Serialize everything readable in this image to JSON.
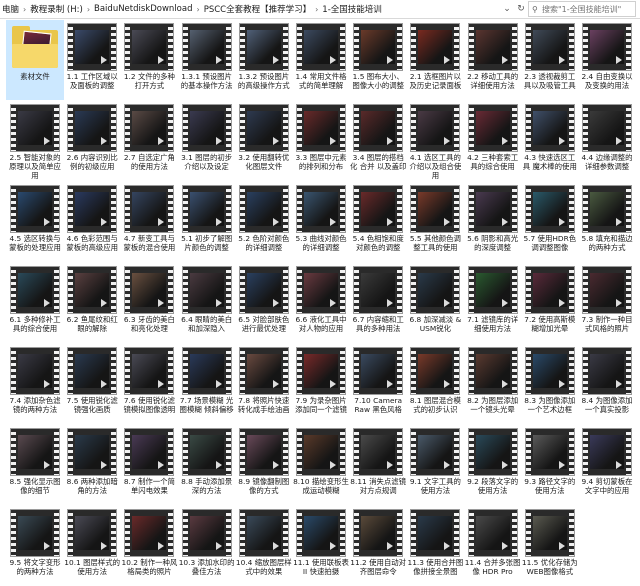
{
  "address": {
    "crumbs": [
      "电脑",
      "教程录制 (H:)",
      "BaiduNetdiskDownload",
      "PSCC全套教程【推荐学习】",
      "1-全国技能培训"
    ],
    "separator": "›",
    "refresh_icon": "refresh-icon",
    "search_placeholder": "搜索\"1-全国技能培训\""
  },
  "files": [
    {
      "name": "素材文件",
      "type": "folder",
      "selected": true
    },
    {
      "name": "1.1 工作区域以及面板的调整",
      "color": "#3a4a6a"
    },
    {
      "name": "1.2 文件的多种打开方式",
      "color": "#4a4a55"
    },
    {
      "name": "1.3.1 预设图片的基本操作方法",
      "color": "#556070"
    },
    {
      "name": "1.3.2 预设图片的高级操作方式",
      "color": "#506078"
    },
    {
      "name": "1.4 常用文件格式的简单理解",
      "color": "#3c4a60"
    },
    {
      "name": "1.5 图布大小、图像大小的调整",
      "color": "#6a3a2a"
    },
    {
      "name": "2.1 选框图片以及历史记录面板",
      "color": "#7a2a20"
    },
    {
      "name": "2.2 移动工具的详细使用方法",
      "color": "#5a3530"
    },
    {
      "name": "2.3 透视裁剪工具以及吸管工具",
      "color": "#404a58"
    },
    {
      "name": "2.4 自由变换以及变换的用法",
      "color": "#6a4060"
    },
    {
      "name": "2.5 智能对象的原理以及简单应用",
      "color": "#3a3a45"
    },
    {
      "name": "2.6 内容识别比例的初级应用",
      "color": "#2a3a55"
    },
    {
      "name": "2.7 自选定广角的使用方法",
      "color": "#5a4a45"
    },
    {
      "name": "3.1 图层的初步介绍以及设定",
      "color": "#3a3a50"
    },
    {
      "name": "3.2 使用翻转优化图层文件",
      "color": "#2e3a50"
    },
    {
      "name": "3.3 图层中元素的排列和分布",
      "color": "#6a2a2a"
    },
    {
      "name": "3.4 图层的搭档化 合并 以及盖印",
      "color": "#5a2a2a"
    },
    {
      "name": "4.1 选区工具的介绍以及组合使用",
      "color": "#4a3a45"
    },
    {
      "name": "4.2 三种套索工具的综合使用",
      "color": "#6a2a35"
    },
    {
      "name": "4.3 快速选区工具 魔术棒的使用",
      "color": "#40506a"
    },
    {
      "name": "4.4 边缘调整的详细参数调整",
      "color": "#3a3a3a"
    },
    {
      "name": "4.5 选区转换与蒙板的处理应用",
      "color": "#2a4a70"
    },
    {
      "name": "4.6 色彩范围与蒙板的高级应用",
      "color": "#2a3a60"
    },
    {
      "name": "4.7 新变工具与蒙板的混合使用",
      "color": "#354560"
    },
    {
      "name": "5.1 初步了解图片颜色的调整",
      "color": "#3a5070"
    },
    {
      "name": "5.2 色阶对颜色的详细调整",
      "color": "#2a4060"
    },
    {
      "name": "5.3 曲线对颜色的详细调整",
      "color": "#3a5570"
    },
    {
      "name": "5.4 色相饱和度对颜色的调整",
      "color": "#6a2a2a"
    },
    {
      "name": "5.5 其他颜色调整工具的使用",
      "color": "#7a3a2a"
    },
    {
      "name": "5.6 阴影和高光的深度调整",
      "color": "#4a3a50"
    },
    {
      "name": "5.7 使用HDR色调调整图像",
      "color": "#2a5a6a"
    },
    {
      "name": "5.8 填充和描边的两种方式",
      "color": "#4a5a40"
    },
    {
      "name": "6.1 多种修补工具的综合使用",
      "color": "#2a4a5a"
    },
    {
      "name": "6.2 鱼尾纹和红眼的解除",
      "color": "#5a4040"
    },
    {
      "name": "6.3 牙齿的美白和亮化处理",
      "color": "#6a5040"
    },
    {
      "name": "6.4 眼睛的美白和加深隐入",
      "color": "#4a3a40"
    },
    {
      "name": "6.5 对脸部肤色进行最优处理",
      "color": "#2a4060"
    },
    {
      "name": "6.6 液化工具中对人物的应用",
      "color": "#6a3a40"
    },
    {
      "name": "6.7 内容缩和工具的多种用法",
      "color": "#3a3a3a"
    },
    {
      "name": "6.8 加深减淡 & USM锐化",
      "color": "#2a3a4a"
    },
    {
      "name": "7.1 滤镜库的详细使用方法",
      "color": "#2a5a30"
    },
    {
      "name": "7.2 使用高斯模糊增加光晕",
      "color": "#5a2a3a"
    },
    {
      "name": "7.3 制作一种目式风格的照片",
      "color": "#4a2a30"
    },
    {
      "name": "7.4 添加杂色滤镜的两种方法",
      "color": "#3a3a45"
    },
    {
      "name": "7.5 使用锐化滤镜强化画质",
      "color": "#2a3a50"
    },
    {
      "name": "7.6 使用锐化滤镜模拟图像透明",
      "color": "#4a4a55"
    },
    {
      "name": "7.7 场景模糊 光圈模糊 倾斜偏移",
      "color": "#2a3a5a"
    },
    {
      "name": "7.8 将照片快速转化成手绘油画",
      "color": "#6a4a40"
    },
    {
      "name": "7.9 为录杂图片添加同一个滤镜",
      "color": "#7a2a2a"
    },
    {
      "name": "7.10 Camera Raw 黑色风格",
      "color": "#3a4a60"
    },
    {
      "name": "8.1 图层混合模式的初步认识",
      "color": "#7a3a2a"
    },
    {
      "name": "8.2 为图层添加一个镜头光晕",
      "color": "#5a3a30"
    },
    {
      "name": "8.3 为图像添加一个艺术边框",
      "color": "#2a4a6a"
    },
    {
      "name": "8.4 为图像添加一个真实投影",
      "color": "#3a3a45"
    },
    {
      "name": "8.5 强化显示图像的细节",
      "color": "#5a4a50"
    },
    {
      "name": "8.6 两种添加暗角的方法",
      "color": "#2a3a4a"
    },
    {
      "name": "8.7 制作一个简单闪电效果",
      "color": "#4a3a55"
    },
    {
      "name": "8.8 手动添加景深的方法",
      "color": "#3a4a45"
    },
    {
      "name": "8.9 镜像翻制图像的方式",
      "color": "#6a4a5a"
    },
    {
      "name": "8.10 描绘变形生成运动模糊",
      "color": "#5a3a2a"
    },
    {
      "name": "8.11 消失点滤镜对方点规调",
      "color": "#4a4a4a"
    },
    {
      "name": "9.1 文字工具的使用方法",
      "color": "#4a5a6a"
    },
    {
      "name": "9.2 段落文字的使用方法",
      "color": "#2a4a5a"
    },
    {
      "name": "9.3 路径文字的使用方法",
      "color": "#5a5a5a"
    },
    {
      "name": "9.4 剪切蒙板在文字中的应用",
      "color": "#3a3a5a"
    },
    {
      "name": "9.5 将文字变形的两种方法",
      "color": "#3a4a55"
    },
    {
      "name": "10.1 图层样式的使用方法",
      "color": "#4a4a55"
    },
    {
      "name": "10.2 制作一种风格局类的照片",
      "color": "#6a2a2a"
    },
    {
      "name": "10.3 添加水印的叠佳方法",
      "color": "#5a3a40"
    },
    {
      "name": "10.4 缩放图层样式中的效果",
      "color": "#3a4a5a"
    },
    {
      "name": "11.1 使用联板表 II 快速拍摄",
      "color": "#2a4a6a"
    },
    {
      "name": "11.2 使用自动对齐图层命令",
      "color": "#5a4a3a"
    },
    {
      "name": "11.3 使用合并图像拼接全景图",
      "color": "#2a3a4a"
    },
    {
      "name": "11.4 合并多张图像 HDR Pro",
      "color": "#4a4a4a"
    },
    {
      "name": "11.5 优化存储为WEB图像格式",
      "color": "#5a5a50"
    }
  ]
}
